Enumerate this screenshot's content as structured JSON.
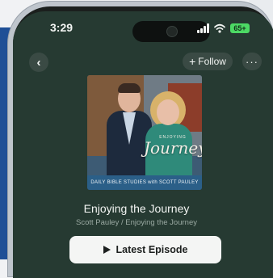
{
  "status_bar": {
    "time": "3:29",
    "battery": "65+"
  },
  "nav": {
    "back_icon": "chevron-left-icon",
    "follow_label": "Follow",
    "more_icon": "ellipsis-icon"
  },
  "podcast": {
    "title": "Enjoying the Journey",
    "subtitle": "Scott Pauley / Enjoying the Journey",
    "artwork": {
      "script_top": "ENJOYING",
      "script": "Journey",
      "banner": "DAILY BIBLE STUDIES with SCOTT PAULEY"
    }
  },
  "actions": {
    "latest_episode_label": "Latest Episode"
  },
  "colors": {
    "screen_bg": "#263a32",
    "button_bg": "#f4f5f4",
    "accent_battery": "#4cd964"
  }
}
